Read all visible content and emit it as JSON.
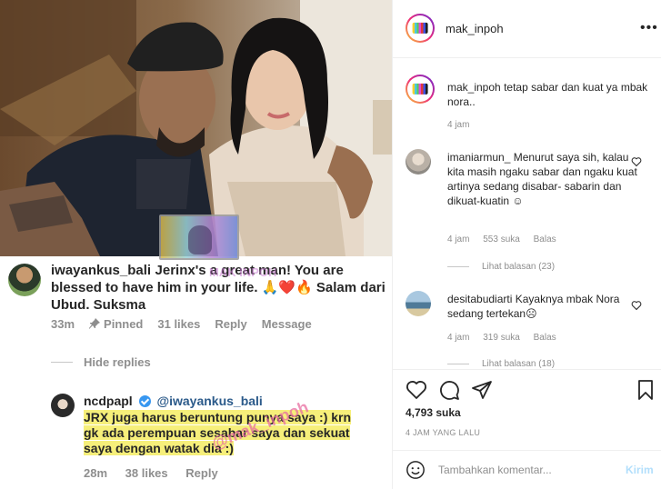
{
  "image": {
    "comment": {
      "username": "iwayankus_bali",
      "text": "Jerinx's a great man! You are blessed to have him in your life. 🙏❤️🔥 Salam dari Ubud. Suksma",
      "time": "33m",
      "pinned_label": "Pinned",
      "likes": "31 likes",
      "reply_label": "Reply",
      "message_label": "Message"
    },
    "hide_replies_label": "Hide replies",
    "reply": {
      "username": "ncdpapl",
      "mention": "@iwayankus_bali",
      "text": "JRX juga harus beruntung punya saya :) krn gk ada perempuan sesabar saya dan sekuat saya dengan watak dia :)",
      "time": "28m",
      "likes": "38 likes",
      "reply_label": "Reply"
    },
    "watermark_small": "MAK INPOH",
    "watermark": "@mak_inpoh"
  },
  "header": {
    "username": "mak_inpoh",
    "more_label": "•••"
  },
  "caption": {
    "username": "mak_inpoh",
    "text": "tetap sabar dan kuat ya mbak nora..",
    "time": "4 jam"
  },
  "comments": [
    {
      "username": "imaniarmun_",
      "text": "Menurut saya sih, kalau kita masih ngaku sabar dan ngaku kuat artinya sedang disabar- sabarin dan dikuat-kuatin ☺",
      "time": "4 jam",
      "likes": "553 suka",
      "reply_label": "Balas",
      "view_replies": "Lihat balasan (23)"
    },
    {
      "username": "desitabudiarti",
      "text": "Kayaknya mbak Nora sedang tertekan☹",
      "time": "4 jam",
      "likes": "319 suka",
      "reply_label": "Balas",
      "view_replies": "Lihat balasan (18)"
    }
  ],
  "actions": {
    "likes": "4,793 suka",
    "post_time": "4 JAM YANG LALU"
  },
  "add_comment": {
    "placeholder": "Tambahkan komentar...",
    "send_label": "Kirim"
  },
  "colors": {
    "highlight": "#f6ef7a",
    "link": "#2b5a8a",
    "send_disabled": "#b2dffc",
    "muted": "#8e8e8e"
  }
}
